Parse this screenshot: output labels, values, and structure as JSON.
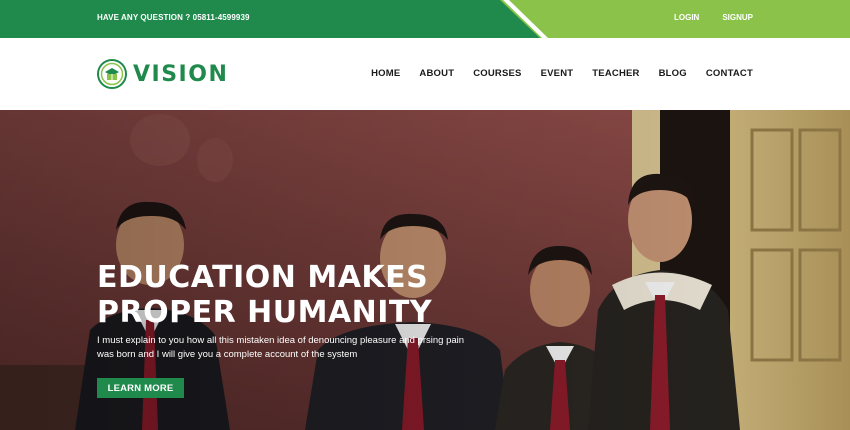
{
  "topbar": {
    "contact_text": "HAVE ANY QUESTION ? 05811-4599939",
    "login_label": "LOGIN",
    "signup_label": "SIGNUP",
    "colors": {
      "primary": "#1f8a4c",
      "secondary": "#8bc34a"
    }
  },
  "header": {
    "logo_text": "VISION",
    "logo_icon": "school-emblem-icon",
    "nav": [
      "HOME",
      "ABOUT",
      "COURSES",
      "EVENT",
      "TEACHER",
      "BLOG",
      "CONTACT"
    ]
  },
  "hero": {
    "title_line1": "EDUCATION MAKES",
    "title_line2": "PROPER HUMANITY",
    "description": "I must explain to you how all this mistaken idea of denouncing pleasure and prsing pain was born and I will give you a complete account of the system",
    "cta_label": "LEARN MORE",
    "cta_color": "#1f8a4c"
  }
}
